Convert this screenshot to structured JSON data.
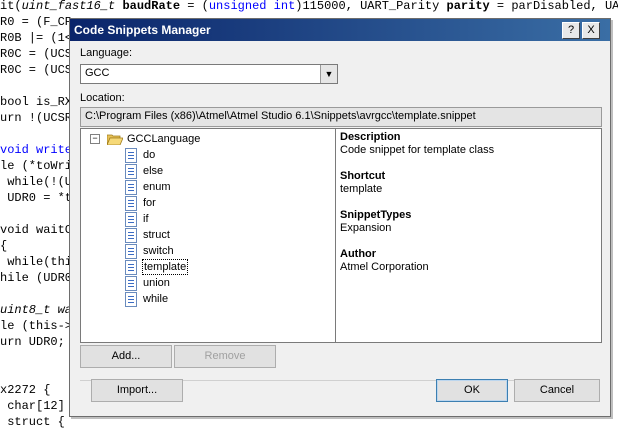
{
  "editor": {
    "lines": [
      {
        "parts": [
          {
            "t": "it(",
            "c": ""
          },
          {
            "t": "uint_fast16_t",
            "c": "it"
          },
          {
            "t": " ",
            "c": ""
          },
          {
            "t": "baudRate",
            "c": "bd"
          },
          {
            "t": " = (",
            "c": ""
          },
          {
            "t": "unsigned int",
            "c": "kw"
          },
          {
            "t": ")115000, ",
            "c": ""
          },
          {
            "t": "UART_Parity",
            "c": ""
          },
          {
            "t": " ",
            "c": ""
          },
          {
            "t": "parity",
            "c": "bd"
          },
          {
            "t": " = parDisabled, UART_",
            "c": ""
          }
        ]
      },
      {
        "parts": [
          {
            "t": "R0 = (F_CP",
            "c": ""
          }
        ]
      },
      {
        "parts": [
          {
            "t": "R0B |= (1<",
            "c": ""
          }
        ]
      },
      {
        "parts": [
          {
            "t": "R0C = (UCS",
            "c": ""
          }
        ]
      },
      {
        "parts": [
          {
            "t": "R0C = (UCS",
            "c": ""
          }
        ]
      },
      {
        "parts": [
          {
            "t": "",
            "c": ""
          }
        ]
      },
      {
        "parts": [
          {
            "t": "bool is_RX",
            "c": ""
          }
        ]
      },
      {
        "parts": [
          {
            "t": "urn !(UCSR",
            "c": ""
          }
        ]
      },
      {
        "parts": [
          {
            "t": "",
            "c": ""
          }
        ]
      },
      {
        "parts": [
          {
            "t": "void write",
            "c": "kw"
          }
        ]
      },
      {
        "parts": [
          {
            "t": "le (*toWri",
            "c": ""
          }
        ]
      },
      {
        "parts": [
          {
            "t": " while(!(U",
            "c": ""
          }
        ]
      },
      {
        "parts": [
          {
            "t": " UDR0 = *t",
            "c": ""
          }
        ]
      },
      {
        "parts": [
          {
            "t": "",
            "c": ""
          }
        ]
      },
      {
        "parts": [
          {
            "t": "void waitC",
            "c": ""
          }
        ]
      },
      {
        "parts": [
          {
            "t": "{",
            "c": ""
          }
        ]
      },
      {
        "parts": [
          {
            "t": " while(thi",
            "c": ""
          }
        ]
      },
      {
        "parts": [
          {
            "t": "hile (UDR0",
            "c": ""
          }
        ]
      },
      {
        "parts": [
          {
            "t": "",
            "c": ""
          }
        ]
      },
      {
        "parts": [
          {
            "t": "uint8_t wa",
            "c": "it"
          }
        ]
      },
      {
        "parts": [
          {
            "t": "le (this->",
            "c": ""
          }
        ]
      },
      {
        "parts": [
          {
            "t": "urn UDR0;",
            "c": ""
          }
        ]
      },
      {
        "parts": [
          {
            "t": "",
            "c": ""
          }
        ]
      },
      {
        "parts": [
          {
            "t": "",
            "c": ""
          }
        ]
      },
      {
        "parts": [
          {
            "t": "x2272 {",
            "c": ""
          }
        ]
      },
      {
        "parts": [
          {
            "t": " char[12]",
            "c": ""
          }
        ]
      },
      {
        "parts": [
          {
            "t": " struct {",
            "c": ""
          }
        ]
      }
    ]
  },
  "dialog": {
    "title": "Code Snippets Manager",
    "help_btn": "?",
    "close_btn": "X",
    "language_label": "Language:",
    "language_value": "GCC",
    "location_label": "Location:",
    "location_value": "C:\\Program Files (x86)\\Atmel\\Atmel Studio 6.1\\Snippets\\avrgcc\\template.snippet",
    "tree": {
      "root_label": "GCCLanguage",
      "items": [
        "do",
        "else",
        "enum",
        "for",
        "if",
        "struct",
        "switch",
        "template",
        "union",
        "while"
      ],
      "selected": "template"
    },
    "details": {
      "description_h": "Description",
      "description": "Code snippet for template class",
      "shortcut_h": "Shortcut",
      "shortcut": "template",
      "types_h": "SnippetTypes",
      "types": "Expansion",
      "author_h": "Author",
      "author": "Atmel Corporation"
    },
    "buttons": {
      "add": "Add...",
      "remove": "Remove",
      "import": "Import...",
      "ok": "OK",
      "cancel": "Cancel"
    }
  },
  "colors": {
    "titlebar_start": "#0a246a",
    "titlebar_end": "#3a6ea5",
    "keyword": "#0000ff"
  }
}
